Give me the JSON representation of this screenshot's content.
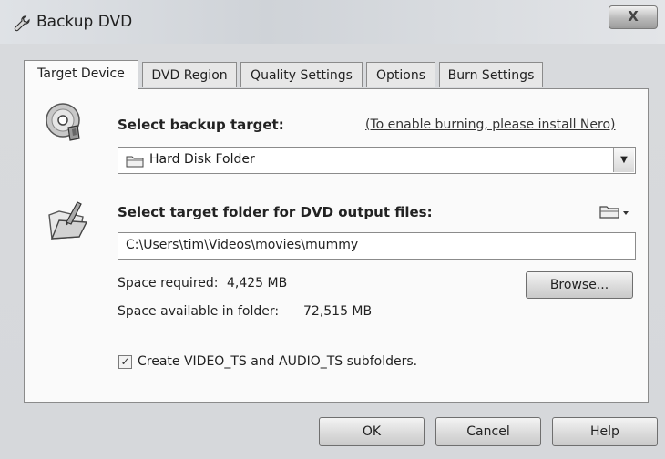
{
  "window": {
    "title": "Backup DVD",
    "close_label": "X"
  },
  "tabs": [
    {
      "label": "Target Device",
      "active": true
    },
    {
      "label": "DVD Region",
      "active": false
    },
    {
      "label": "Quality Settings",
      "active": false
    },
    {
      "label": "Options",
      "active": false
    },
    {
      "label": "Burn Settings",
      "active": false
    }
  ],
  "target": {
    "heading": "Select backup target:",
    "nero_link": "(To enable burning, please install Nero)",
    "selected": "Hard Disk Folder"
  },
  "folder": {
    "heading": "Select target folder for DVD output files:",
    "path": "C:\\Users\\tim\\Videos\\movies\\mummy",
    "space_required_label": "Space required:",
    "space_required_value": "4,425 MB",
    "space_available_label": "Space available in folder:",
    "space_available_value": "72,515 MB",
    "browse_label": "Browse..."
  },
  "subfolders": {
    "label": "Create VIDEO_TS and AUDIO_TS subfolders.",
    "checked": true,
    "check_mark": "✓"
  },
  "footer": {
    "ok_label": "OK",
    "cancel_label": "Cancel",
    "help_label": "Help"
  },
  "icons": [
    "dvd-disc-icon",
    "folder-write-icon",
    "folder-icon",
    "wrench-icon",
    "dropdown-arrow-icon"
  ]
}
